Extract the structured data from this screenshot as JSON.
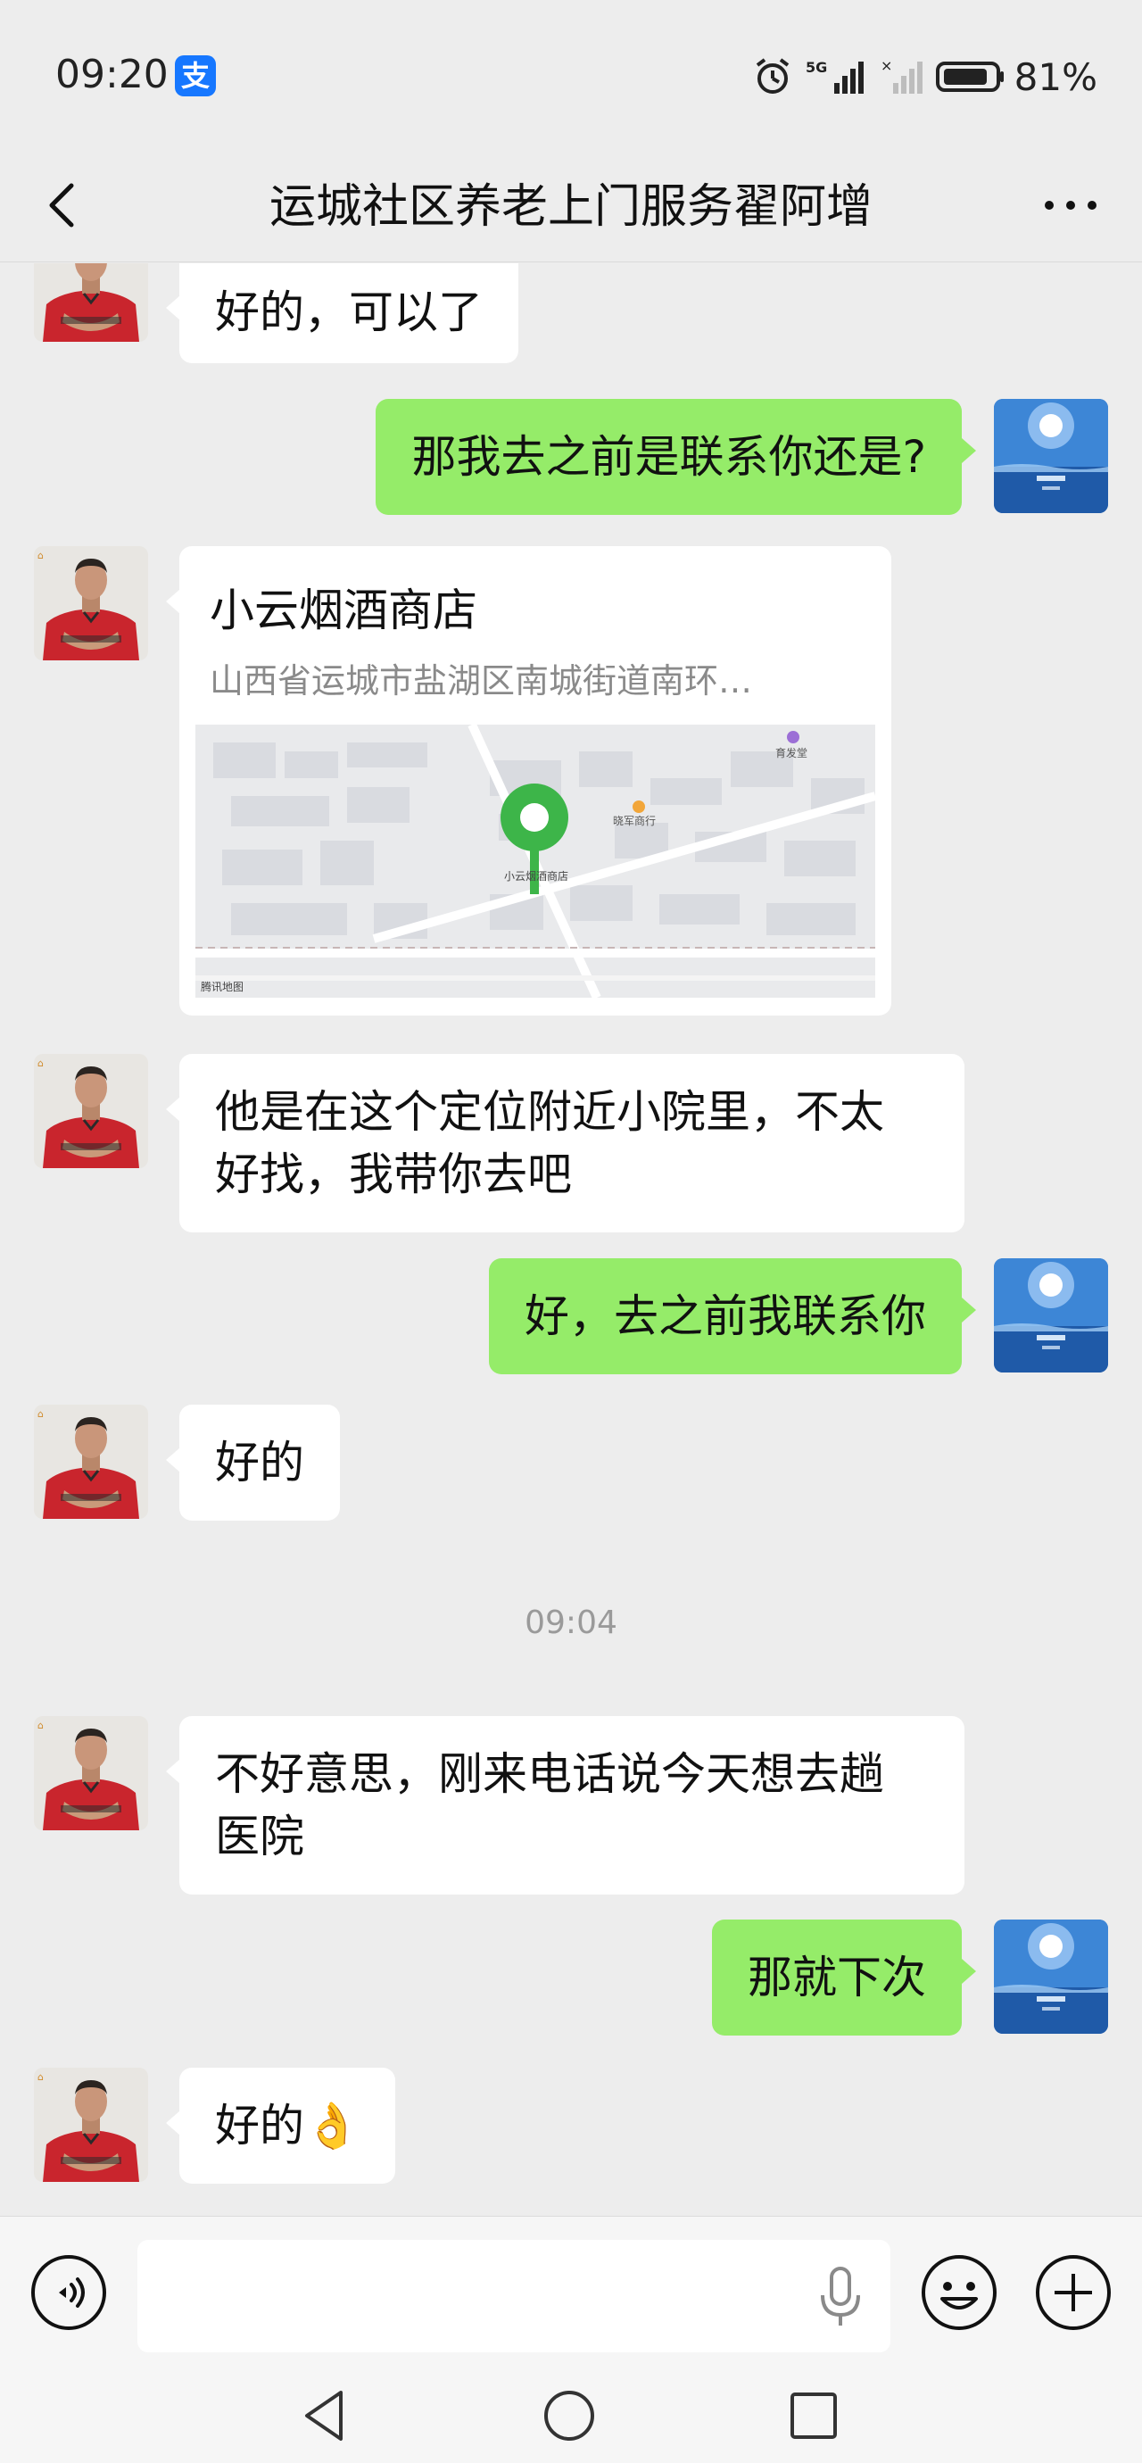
{
  "status_bar": {
    "time": "09:20",
    "alipay_badge": "支",
    "network": "5G",
    "battery": "81%"
  },
  "header": {
    "title": "运城社区养老上门服务翟阿增",
    "back_icon": "chevron-left-icon",
    "more_icon": "more-horizontal-icon"
  },
  "messages": [
    {
      "side": "in",
      "text": "好的，可以了"
    },
    {
      "side": "out",
      "text": "那我去之前是联系你还是?"
    },
    {
      "side": "in",
      "type": "location",
      "name": "小云烟酒商店",
      "address": "山西省运城市盐湖区南城街道南环…",
      "map_labels": {
        "pin_label": "小云烟酒商店",
        "poi_1": "晓军商行",
        "poi_2": "育发堂",
        "provider": "腾讯地图"
      }
    },
    {
      "side": "in",
      "text_lines": [
        "他是在这个定位附近小院里，不太",
        "好找，我带你去吧"
      ]
    },
    {
      "side": "out",
      "text": "好，去之前我联系你"
    },
    {
      "side": "in",
      "text": "好的"
    },
    {
      "type": "timestamp",
      "text": "09:04"
    },
    {
      "side": "in",
      "text_lines": [
        "不好意思，刚来电话说今天想去趟",
        "医院"
      ]
    },
    {
      "side": "out",
      "text": "那就下次"
    },
    {
      "side": "in",
      "text": "好的👌"
    }
  ],
  "input_bar": {
    "message_value": "",
    "voice_icon": "voice-icon",
    "mic_icon": "microphone-icon",
    "emoji_icon": "emoji-icon",
    "plus_icon": "plus-circle-icon"
  },
  "colors": {
    "background": "#ededed",
    "incoming_bubble": "#ffffff",
    "outgoing_bubble": "#95ec69",
    "timestamp": "#9a9a9a",
    "pin": "#3db549"
  }
}
